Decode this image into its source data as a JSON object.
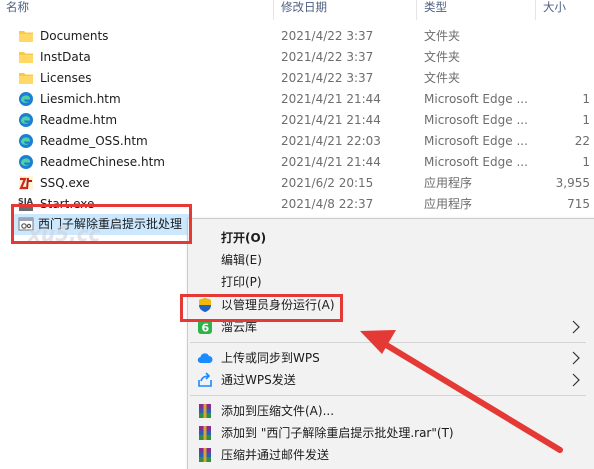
{
  "header": {
    "name": "名称",
    "date": "修改日期",
    "type": "类型",
    "size": "大小"
  },
  "files": [
    {
      "icon": "folder-icon",
      "name": "Documents",
      "date": "2021/4/22 3:37",
      "type": "文件夹",
      "size": ""
    },
    {
      "icon": "folder-icon",
      "name": "InstData",
      "date": "2021/4/22 3:37",
      "type": "文件夹",
      "size": ""
    },
    {
      "icon": "folder-icon",
      "name": "Licenses",
      "date": "2021/4/22 3:37",
      "type": "文件夹",
      "size": ""
    },
    {
      "icon": "edge-icon",
      "name": "Liesmich.htm",
      "date": "2021/4/21 21:44",
      "type": "Microsoft Edge ...",
      "size": "1"
    },
    {
      "icon": "edge-icon",
      "name": "Readme.htm",
      "date": "2021/4/21 21:44",
      "type": "Microsoft Edge ...",
      "size": "1"
    },
    {
      "icon": "edge-icon",
      "name": "Readme_OSS.htm",
      "date": "2021/4/21 22:03",
      "type": "Microsoft Edge ...",
      "size": "22"
    },
    {
      "icon": "edge-icon",
      "name": "ReadmeChinese.htm",
      "date": "2021/4/21 21:44",
      "type": "Microsoft Edge ...",
      "size": "1"
    },
    {
      "icon": "ssq-app-icon",
      "name": "SSQ.exe",
      "date": "2021/6/2 20:15",
      "type": "应用程序",
      "size": "3,955"
    },
    {
      "icon": "start-app-icon",
      "name": "Start.exe",
      "date": "2021/4/8 22:37",
      "type": "应用程序",
      "size": "715"
    }
  ],
  "selected_file": {
    "icon": "batch-file-icon",
    "name": "西门子解除重启提示批处理"
  },
  "watermark": "xu5.cc",
  "context_menu": {
    "open": "打开(O)",
    "edit": "编辑(E)",
    "print": "打印(P)",
    "run_as_admin": "以管理员身份运行(A)",
    "cloud_library": "溜云库",
    "upload_sync_wps": "上传或同步到WPS",
    "send_wps": "通过WPS发送",
    "add_archive": "添加到压缩文件(A)...",
    "add_to_rar": "添加到 \"西门子解除重启提示批处理.rar\"(T)",
    "compress_email": "压缩并通过邮件发送"
  },
  "colors": {
    "highlight_red": "#e53935",
    "selection_blue": "#cce8ff",
    "menu_bg": "#f2f2f2"
  }
}
